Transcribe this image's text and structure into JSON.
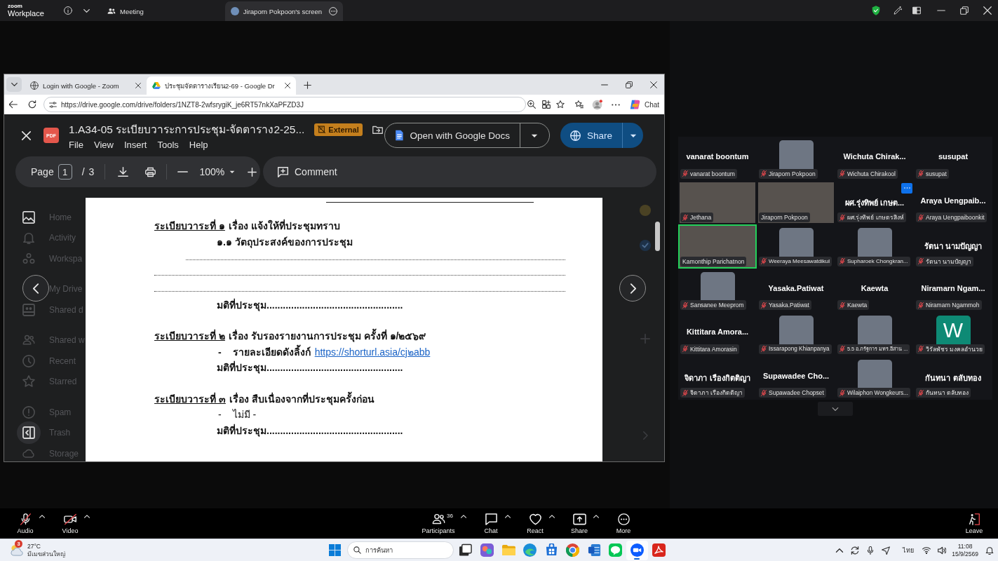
{
  "zoom_titlebar": {
    "logo_top": "zoom",
    "logo_bottom": "Workplace",
    "tabs": [
      {
        "kind": "meeting",
        "label": "Meeting",
        "selected": false
      },
      {
        "kind": "screen",
        "label": "Jiraporn Pokpoon's screen",
        "selected": true
      }
    ]
  },
  "browser": {
    "tabs": [
      {
        "kind": "globe",
        "label": "Login with Google - Zoom",
        "selected": false
      },
      {
        "kind": "drive",
        "label": "ประชุมจัดตารางเรียน2-69 - Google Dr",
        "selected": true
      }
    ],
    "url": "https://drive.google.com/drive/folders/1NZT8-2wfsrygiK_je6RT57nkXaPFZD3J",
    "assistant_label": "Chat"
  },
  "viewer": {
    "file_type": "PDF",
    "title": "1.A34-05 ระเบียบวาระการประชุม-จัดตาราง2-25...",
    "badge": "External",
    "menus": [
      "File",
      "View",
      "Insert",
      "Tools",
      "Help"
    ],
    "open_with": "Open with Google Docs",
    "share": "Share",
    "page_label": "Page",
    "page_value": "1",
    "page_separator": "/",
    "page_count": "3",
    "zoom_level": "100%",
    "comment": "Comment"
  },
  "drive_sidebar": {
    "groups": [
      [
        {
          "label": "Home",
          "kind": "home"
        },
        {
          "label": "Activity",
          "kind": "activity"
        },
        {
          "label": "Workspa",
          "kind": "workspaces"
        }
      ],
      [
        {
          "label": "My Drive",
          "kind": "my_drive"
        },
        {
          "label": "Shared d",
          "kind": "shared_drives"
        }
      ],
      [
        {
          "label": "Shared w",
          "kind": "shared_with_me"
        },
        {
          "label": "Recent",
          "kind": "recent"
        },
        {
          "label": "Starred",
          "kind": "starred"
        }
      ],
      [
        {
          "label": "Spam",
          "kind": "spam"
        },
        {
          "label": "Trash",
          "kind": "trash"
        },
        {
          "label": "Storage",
          "kind": "storage"
        }
      ]
    ]
  },
  "document": {
    "lines": [
      {
        "kind": "heading",
        "number": "ระเบียบวาระที่ ๑",
        "text": "เรื่อง แจ้งให้ที่ประชุมทราบ"
      },
      {
        "kind": "subheading",
        "text": "๑.๑ วัตถุประสงค์ของการประชุม"
      },
      {
        "kind": "blank_indented"
      },
      {
        "kind": "blank"
      },
      {
        "kind": "blank"
      },
      {
        "kind": "resolution",
        "text": "มติที่ประชุม.................................................."
      },
      {
        "kind": "heading",
        "number": "ระเบียบวาระที่ ๒",
        "text": "เรื่อง รับรองรายงานการประชุม ครั้งที่ ๑/๒๕๖๙"
      },
      {
        "kind": "bullet",
        "marker": "-",
        "text": "รายละเอียดดังลิ้งก์",
        "link": "https://shorturl.asia/cj๒abb",
        "bold": true
      },
      {
        "kind": "resolution",
        "text": "มติที่ประชุม.................................................."
      },
      {
        "kind": "heading",
        "number": "ระเบียบวาระที่ ๓",
        "text": "เรื่อง สืบเนื่องจากที่ประชุมครั้งก่อน"
      },
      {
        "kind": "bullet",
        "marker": "-",
        "text": "ไม่มี -",
        "bold": false
      },
      {
        "kind": "resolution",
        "text": "มติที่ประชุม.................................................."
      }
    ]
  },
  "gallery": {
    "tiles": [
      {
        "kind": "name",
        "title": "vanarat boontum",
        "label": "vanarat boontum",
        "muted": true,
        "speaking": false,
        "options_button": false
      },
      {
        "kind": "photo",
        "label": "Jiraporn Pokpoon",
        "muted": true,
        "speaking": false,
        "options_button": false
      },
      {
        "kind": "name",
        "title": "Wichuta Chirak...",
        "label": "Wichuta Chirakool",
        "muted": true,
        "speaking": false,
        "options_button": false
      },
      {
        "kind": "name",
        "title": "susupat",
        "label": "susupat",
        "muted": true,
        "speaking": false,
        "options_button": false
      },
      {
        "kind": "video",
        "label": "Jethana",
        "muted": true,
        "speaking": false,
        "options_button": false
      },
      {
        "kind": "video",
        "label": "Jiraporn Pokpoon",
        "muted": false,
        "speaking": false,
        "options_button": false
      },
      {
        "kind": "name",
        "title": "ผศ.รุ่งทิพย์ เกษต...",
        "label": "ผศ.รุ่งทิพย์ เกษตรสิงห์",
        "muted": true,
        "speaking": false,
        "options_button": true
      },
      {
        "kind": "name",
        "title": "Araya Uengpaib...",
        "label": "Araya Uengpaiboonkit",
        "muted": true,
        "speaking": false,
        "options_button": false
      },
      {
        "kind": "video",
        "label": "Kamonthip Parichatnon",
        "muted": false,
        "speaking": true,
        "options_button": false
      },
      {
        "kind": "photo",
        "label": "Weeraya Meesawatdikul",
        "muted": true,
        "speaking": false,
        "options_button": false
      },
      {
        "kind": "photo",
        "label": "Supharoek Chongkran...",
        "muted": true,
        "speaking": false,
        "options_button": false
      },
      {
        "kind": "name",
        "title": "รัตนา นามปัญญา",
        "label": "รัตนา นามปัญญา",
        "muted": true,
        "speaking": false,
        "options_button": false
      },
      {
        "kind": "photo",
        "label": "Sansanee Meeprom",
        "muted": true,
        "speaking": false,
        "options_button": false
      },
      {
        "kind": "name",
        "title": "Yasaka.Patiwat",
        "label": "Yasaka.Patiwat",
        "muted": true,
        "speaking": false,
        "options_button": false
      },
      {
        "kind": "name",
        "title": "Kaewta",
        "label": "Kaewta",
        "muted": true,
        "speaking": false,
        "options_button": false
      },
      {
        "kind": "name",
        "title": "Niramarn Ngam...",
        "label": "Niramarn Ngammoh",
        "muted": true,
        "speaking": false,
        "options_button": false
      },
      {
        "kind": "name",
        "title": "Kittitara Amora...",
        "label": "Kittitara Amorasin",
        "muted": true,
        "speaking": false,
        "options_button": false
      },
      {
        "kind": "photo",
        "label": "Issarapong Khianpanya",
        "muted": true,
        "speaking": false,
        "options_button": false
      },
      {
        "kind": "photo",
        "label": "5.5 อ.ภรัฐการ มทร.อีสาน ...",
        "muted": true,
        "speaking": false,
        "options_button": false
      },
      {
        "kind": "letter",
        "letter": "W",
        "label": "วิรัลพัชร มงคลอำนวย",
        "muted": true,
        "speaking": false,
        "options_button": false
      },
      {
        "kind": "name",
        "title": "จิดาภา เรืองกิตติญา",
        "label": "จิดาภา เรืองกิตติญา",
        "muted": true,
        "speaking": false,
        "options_button": false
      },
      {
        "kind": "name",
        "title": "Supawadee Cho...",
        "label": "Supawadee Chopset",
        "muted": true,
        "speaking": false,
        "options_button": false
      },
      {
        "kind": "photo",
        "label": "Wilaiphon Wongkeurs...",
        "muted": true,
        "speaking": false,
        "options_button": false
      },
      {
        "kind": "name",
        "title": "กันทนา ตลับทอง",
        "label": "กันทนา ตลับทอง",
        "muted": true,
        "speaking": false,
        "options_button": false
      }
    ]
  },
  "meeting_toolbar": {
    "left": [
      {
        "kind": "audio",
        "label": "Audio",
        "off": true,
        "menu": true
      },
      {
        "kind": "video",
        "label": "Video",
        "off": true,
        "menu": true
      }
    ],
    "center": [
      {
        "kind": "participants",
        "label": "Participants",
        "count": "36",
        "menu": true
      },
      {
        "kind": "chat",
        "label": "Chat",
        "menu": true
      },
      {
        "kind": "react",
        "label": "React",
        "menu": true
      },
      {
        "kind": "share",
        "label": "Share",
        "menu": true
      },
      {
        "kind": "more",
        "label": "More",
        "menu": false
      }
    ],
    "leave": "Leave"
  },
  "taskbar": {
    "weather": {
      "alerts": "3",
      "temperature": "27°C",
      "condition": "มีเมฆส่วนใหญ่"
    },
    "search_placeholder": "การค้นหา",
    "apps": [
      {
        "kind": "task_view",
        "selected": false
      },
      {
        "kind": "office",
        "selected": false
      },
      {
        "kind": "files",
        "selected": false
      },
      {
        "kind": "edge",
        "selected": false
      },
      {
        "kind": "store",
        "selected": false
      },
      {
        "kind": "chrome",
        "selected": false
      },
      {
        "kind": "word",
        "selected": false
      },
      {
        "kind": "line",
        "selected": false
      },
      {
        "kind": "zoom",
        "selected": true
      },
      {
        "kind": "pdf",
        "selected": false
      }
    ],
    "language": "ไทย",
    "time": "11:08",
    "date": "15/9/2569"
  }
}
